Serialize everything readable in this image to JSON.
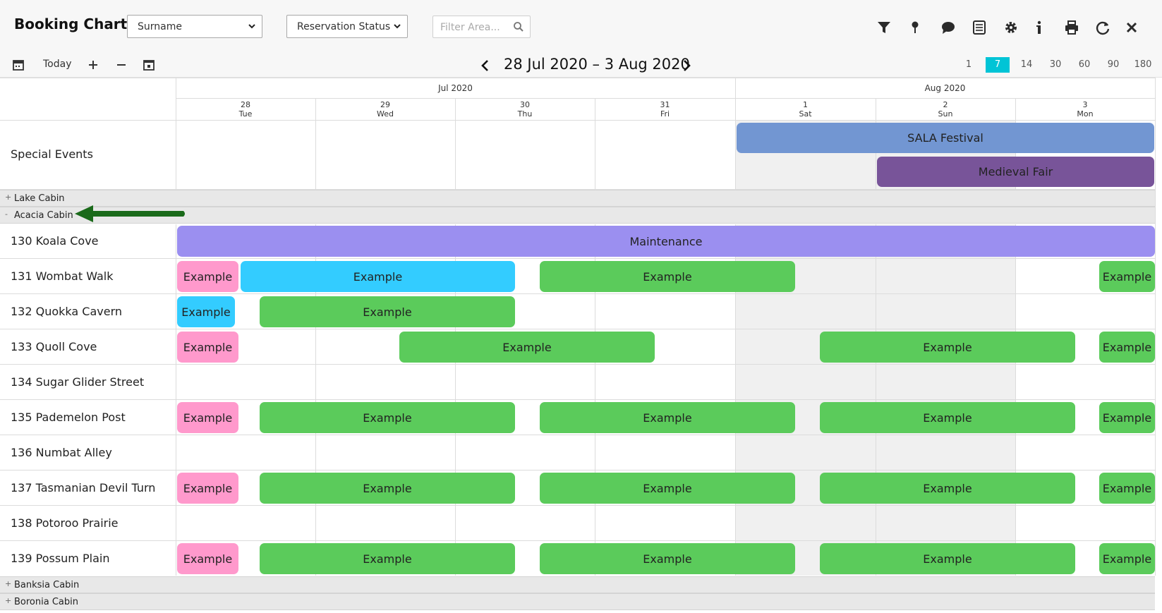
{
  "header": {
    "title": "Booking Chart",
    "select_sort": "Surname",
    "select_status": "Reservation Status",
    "filter_placeholder": "Filter Area...",
    "icons": [
      "filter-icon",
      "map-pin-icon",
      "chat-icon",
      "calculator-icon",
      "settings-icon",
      "info-icon",
      "print-icon",
      "refresh-icon",
      "close-icon"
    ]
  },
  "toolbar": {
    "today_label": "Today",
    "date_range": "28 Jul 2020 – 3 Aug 2020",
    "zoom_options": [
      "1",
      "7",
      "14",
      "30",
      "60",
      "90",
      "180"
    ],
    "zoom_selected": "7",
    "accent_color": "#00c4d6"
  },
  "calendar": {
    "months": [
      "Jul 2020",
      "Aug 2020"
    ],
    "days": [
      {
        "num": "28",
        "dow": "Tue"
      },
      {
        "num": "29",
        "dow": "Wed"
      },
      {
        "num": "30",
        "dow": "Thu"
      },
      {
        "num": "31",
        "dow": "Fri"
      },
      {
        "num": "1",
        "dow": "Sat"
      },
      {
        "num": "2",
        "dow": "Sun"
      },
      {
        "num": "3",
        "dow": "Mon"
      }
    ]
  },
  "special_events": {
    "label": "Special Events",
    "events": [
      {
        "name": "SALA Festival",
        "color": "#7296d2"
      },
      {
        "name": "Medieval Fair",
        "color": "#785499"
      }
    ]
  },
  "groups": [
    {
      "label": "Lake Cabin",
      "toggle": "+"
    },
    {
      "label": "Acacia Cabin",
      "toggle": "-"
    },
    {
      "label": "Banksia Cabin",
      "toggle": "+"
    },
    {
      "label": "Boronia Cabin",
      "toggle": "+"
    }
  ],
  "rooms": [
    "130 Koala Cove",
    "131 Wombat Walk",
    "132 Quokka Cavern",
    "133 Quoll Cove",
    "134 Sugar Glider Street",
    "135 Pademelon Post",
    "136 Numbat Alley",
    "137 Tasmanian Devil Turn",
    "138 Potoroo Prairie",
    "139 Possum Plain"
  ],
  "bookings": {
    "maintenance_label": "Maintenance",
    "example_label": "Example"
  },
  "status_colors": {
    "unconfirmed": "#ff99cc",
    "arrived": "#33ccff",
    "confirmed": "#5bcb5b",
    "maintenance": "#9b8ff0"
  }
}
